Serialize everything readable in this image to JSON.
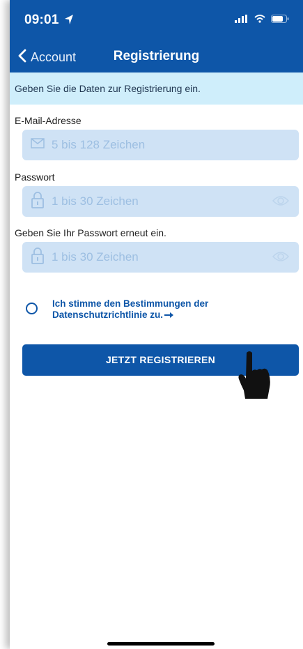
{
  "status_bar": {
    "time": "09:01"
  },
  "nav": {
    "back_label": "Account",
    "title": "Registrierung"
  },
  "banner": {
    "text": "Geben Sie die Daten zur Registrierung ein."
  },
  "form": {
    "email_label": "E-Mail-Adresse",
    "email_placeholder": "5 bis 128 Zeichen",
    "password_label": "Passwort",
    "password_placeholder": "1 bis 30 Zeichen",
    "confirm_label": "Geben Sie Ihr Passwort erneut ein.",
    "confirm_placeholder": "1 bis 30 Zeichen"
  },
  "consent": {
    "line1": "Ich stimme den Bestimmungen der",
    "line2": "Datenschutzrichtlinie zu."
  },
  "register_button": {
    "label": "JETZT REGISTRIEREN"
  },
  "colors": {
    "primary": "#0e56a8",
    "banner": "#cfeefb",
    "input_bg": "#cfe2f5"
  }
}
